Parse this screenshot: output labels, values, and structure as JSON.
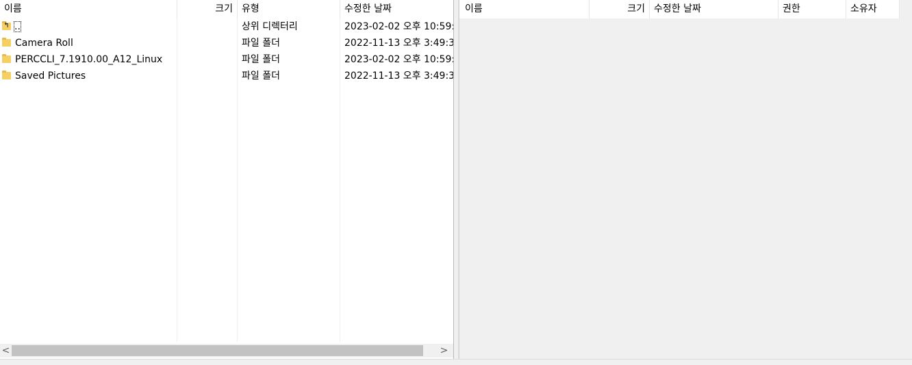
{
  "left": {
    "columns": {
      "name": "이름",
      "size": "크기",
      "type": "유형",
      "modified": "수정한 날짜"
    },
    "sort_indicator": "^",
    "rows": [
      {
        "name": "..",
        "type": "상위 디렉터리",
        "modified": "2023-02-02  오후 10:59:",
        "icon": "parent-dir-icon"
      },
      {
        "name": "Camera Roll",
        "type": "파일 폴더",
        "modified": "2022-11-13  오후 3:49:3",
        "icon": "folder-icon"
      },
      {
        "name": "PERCCLI_7.1910.00_A12_Linux",
        "type": "파일 폴더",
        "modified": "2023-02-02  오후 10:59:",
        "icon": "folder-icon"
      },
      {
        "name": "Saved Pictures",
        "type": "파일 폴더",
        "modified": "2022-11-13  오후 3:49:3",
        "icon": "folder-icon"
      }
    ],
    "scrollbar": {
      "left_arrow": "<",
      "right_arrow": ">"
    }
  },
  "right": {
    "columns": {
      "name": "이름",
      "size": "크기",
      "modified": "수정한 날짜",
      "permissions": "권한",
      "owner": "소유자"
    },
    "sort_indicator": "^"
  }
}
